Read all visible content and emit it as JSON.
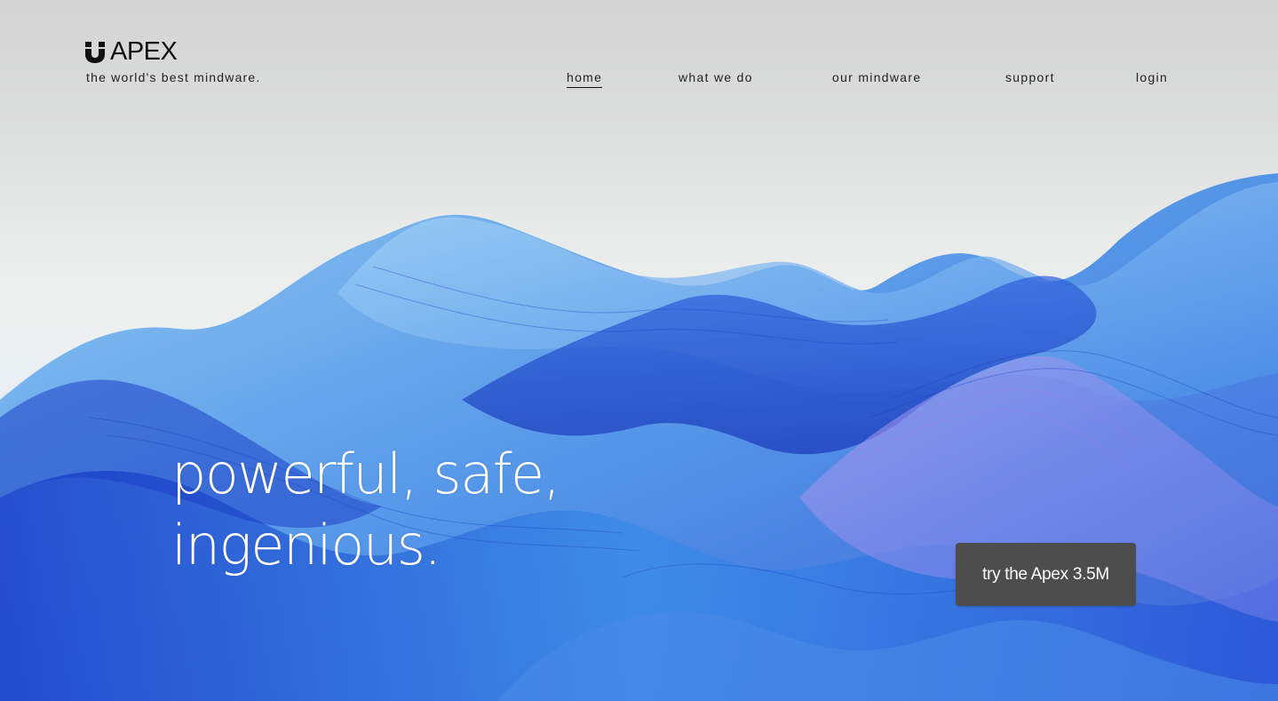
{
  "brand": {
    "name": "APEX",
    "tagline": "the world's best mindware.",
    "logo_icon": "u-magnet-icon"
  },
  "nav": {
    "items": [
      {
        "label": "home",
        "active": true
      },
      {
        "label": "what we do",
        "active": false
      },
      {
        "label": "our mindware",
        "active": false
      },
      {
        "label": "support",
        "active": false
      },
      {
        "label": "login",
        "active": false
      }
    ]
  },
  "hero": {
    "headline_line1": "powerful, safe,",
    "headline_line2": "ingenious.",
    "cta_label": "try the Apex 3.5M"
  },
  "colors": {
    "text_dark": "#111111",
    "cta_background": "#4d4d4d",
    "cta_text": "#ffffff",
    "art_blue": "#1f4fd6",
    "art_light_blue": "#5ba9ee",
    "art_violet": "#9b7be8"
  }
}
